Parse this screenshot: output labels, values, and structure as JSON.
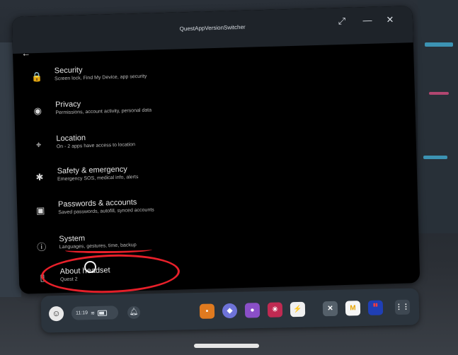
{
  "window": {
    "title": "QuestAppVersionSwitcher",
    "controls": [
      "expand-icon",
      "minimize-icon",
      "close-icon"
    ]
  },
  "settings": [
    {
      "icon": "lock-icon",
      "title": "Security",
      "subtitle": "Screen lock, Find My Device, app security"
    },
    {
      "icon": "privacy-eye-icon",
      "title": "Privacy",
      "subtitle": "Permissions, account activity, personal data"
    },
    {
      "icon": "location-pin-icon",
      "title": "Location",
      "subtitle": "On - 2 apps have access to location"
    },
    {
      "icon": "asterisk-icon",
      "title": "Safety & emergency",
      "subtitle": "Emergency SOS, medical info, alerts"
    },
    {
      "icon": "account-box-icon",
      "title": "Passwords & accounts",
      "subtitle": "Saved passwords, autofill, synced accounts"
    },
    {
      "icon": "info-icon",
      "title": "System",
      "subtitle": "Languages, gestures, time, backup"
    },
    {
      "icon": "headset-icon",
      "title": "About headset",
      "subtitle": "Quest 2"
    }
  ],
  "dock": {
    "time": "11:19",
    "apps": [
      {
        "name": "store-app",
        "color": "#e07a1f"
      },
      {
        "name": "explore-app",
        "color": "#6e73d8"
      },
      {
        "name": "people-app",
        "color": "#8a4fc8"
      },
      {
        "name": "game-app",
        "color": "#c02a52"
      },
      {
        "name": "android-app",
        "color": "#f0f0f0"
      },
      {
        "name": "xbox-app",
        "color": "#55606a"
      },
      {
        "name": "m-app",
        "color": "#f6f6f6"
      },
      {
        "name": "beat-saber-app",
        "color": "#1f3fb5"
      },
      {
        "name": "app-library",
        "color": "#3e4852"
      }
    ]
  }
}
